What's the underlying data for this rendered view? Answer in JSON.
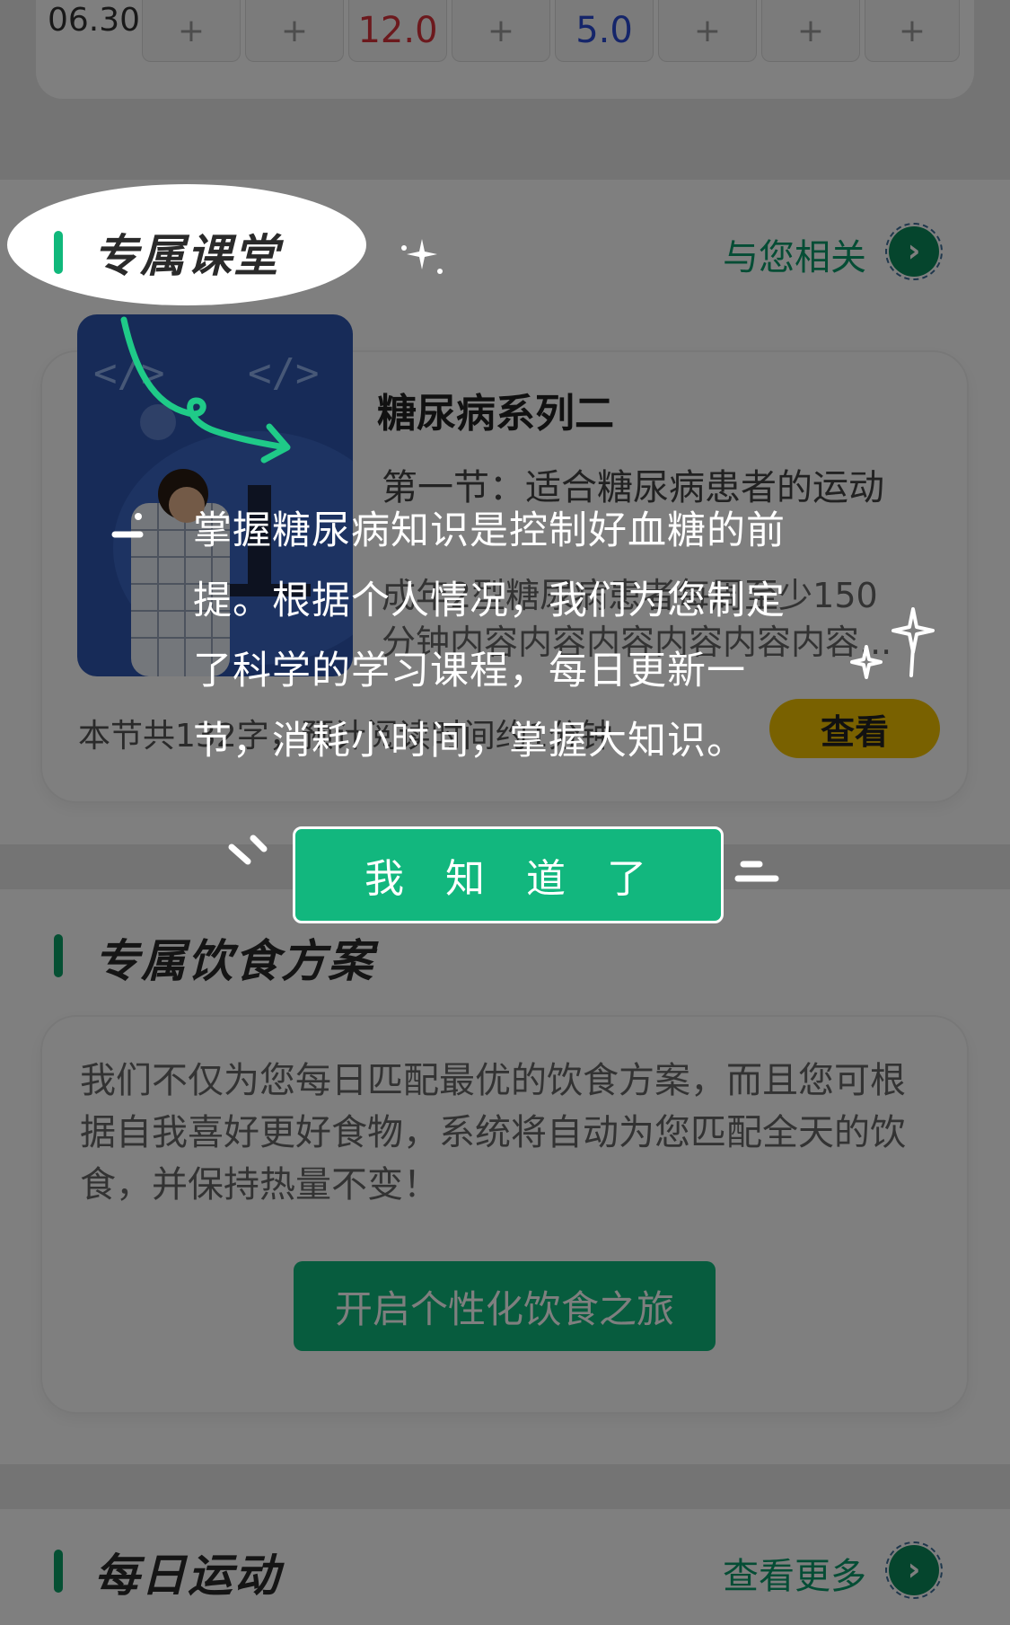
{
  "glucose_row": {
    "date": "06.30",
    "cells": [
      "+",
      "+",
      "12.0",
      "+",
      "5.0",
      "+",
      "+",
      "+"
    ]
  },
  "classroom": {
    "title": "专属课堂",
    "link": "与您相关",
    "course": {
      "title": "糖尿病系列二",
      "subtitle": "第一节：适合糖尿病患者的运动",
      "desc_line1": "成年2型糖尿病患者每周至少150",
      "desc_line2": "分钟内容内容内容内容内容内容...",
      "footer": "本节共132字，预计阅读时间约1分钟",
      "view_button": "查看"
    }
  },
  "diet": {
    "title": "专属饮食方案",
    "description": "我们不仅为您每日匹配最优的饮食方案，而且您可根据自我喜好更好食物，系统将自动为您匹配全天的饮食，并保持热量不变！",
    "button": "开启个性化饮食之旅"
  },
  "exercise": {
    "title": "每日运动",
    "link": "查看更多"
  },
  "guide": {
    "line1": "掌握糖尿病知识是控制好血糖的前",
    "line2": "提。根据个人情况，我们为您制定",
    "line3": "了科学的学习课程，每日更新一",
    "line4": "节，消耗小时间，掌握大知识。",
    "confirm_button": "我  知  道  了",
    "highlight_title": "专属课堂"
  },
  "colors": {
    "accent_green": "#12b77e",
    "section_bar": "#0aa066",
    "view_button_yellow": "#f2c300",
    "red_value": "#d9323a",
    "blue_value": "#2a4bd4"
  },
  "icons": [
    "chevron-right-icon",
    "plus-icon",
    "sparkle-icon",
    "arrow-curve-icon"
  ]
}
